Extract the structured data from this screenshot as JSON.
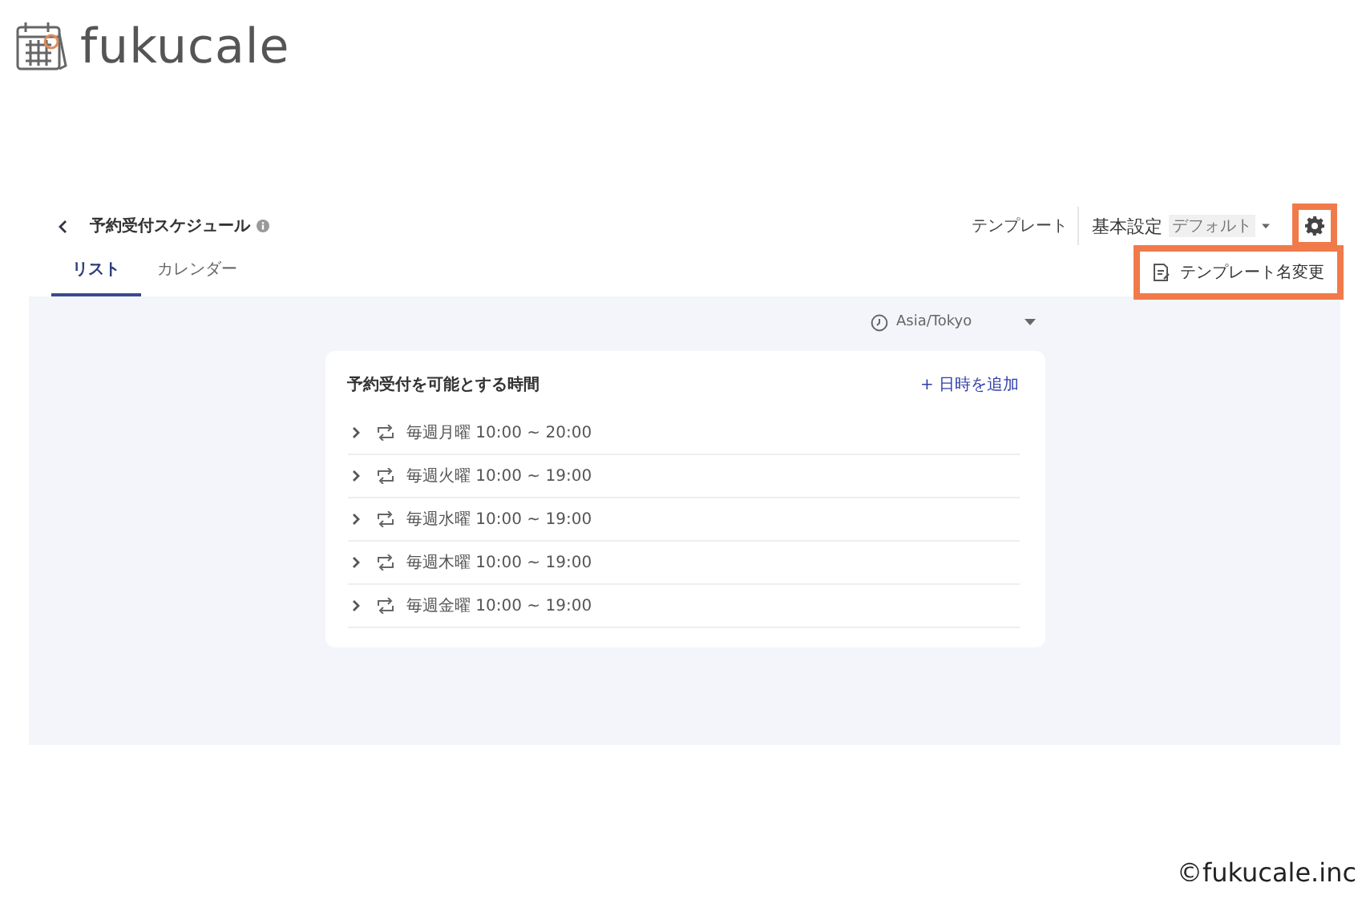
{
  "logo": {
    "text": "fukucale"
  },
  "header": {
    "title": "予約受付スケジュール",
    "template_label": "テンプレート",
    "template": {
      "value": "基本設定",
      "badge": "デフォルト"
    }
  },
  "tabs": [
    {
      "label": "リスト",
      "selected": true
    },
    {
      "label": "カレンダー",
      "selected": false
    }
  ],
  "menu": {
    "items": [
      {
        "label": "テンプレート名変更"
      }
    ]
  },
  "timezone": "Asia/Tokyo",
  "card": {
    "title": "予約受付を可能とする時間",
    "add_link": "+ 日時を追加",
    "rows": [
      {
        "label": "毎週月曜 10:00 ~ 20:00",
        "expanded": false
      },
      {
        "label": "毎週火曜 10:00 ~ 19:00",
        "expanded": false
      },
      {
        "label": "毎週水曜 10:00 ~ 19:00",
        "expanded": false
      },
      {
        "label": "毎週木曜 10:00 ~ 19:00",
        "expanded": false
      },
      {
        "label": "毎週金曜 10:00 ~ 19:00",
        "expanded": false
      }
    ]
  },
  "copyright": "©fukucale.inc"
}
